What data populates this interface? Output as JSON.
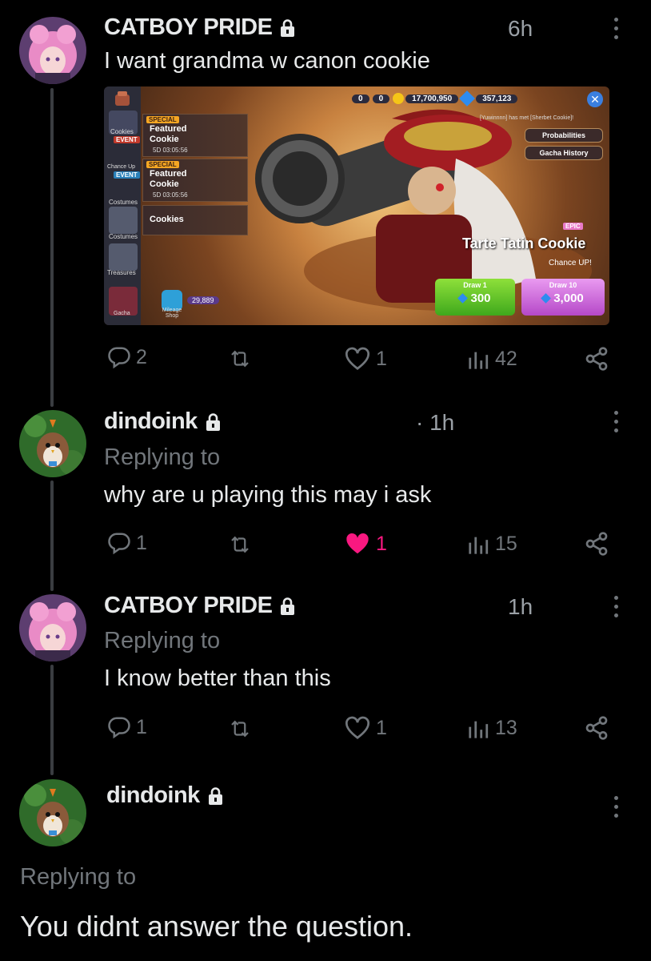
{
  "posts": [
    {
      "author": "CATBOY PRIDE",
      "time": "6h",
      "text": "I want grandma w canon cookie",
      "replies": "2",
      "likes": "1",
      "views": "42"
    },
    {
      "author": "dindoink",
      "time": "· 1h",
      "replying_to": "Replying to",
      "text": "why are u playing this may i ask",
      "replies": "1",
      "likes": "1",
      "views": "15",
      "liked": true
    },
    {
      "author": "CATBOY PRIDE",
      "time": "1h",
      "replying_to": "Replying to",
      "text": "I know better than this",
      "replies": "1",
      "likes": "1",
      "views": "13"
    },
    {
      "author": "dindoink",
      "replying_to": "Replying to",
      "text": "You didnt answer the question."
    }
  ],
  "game": {
    "topbar": {
      "val1": "0",
      "val2": "0",
      "coins": "17,700,950",
      "gems": "357,123"
    },
    "sidebar": [
      "Cookies",
      "EVENT",
      "Chance Up",
      "EVENT",
      "Costumes",
      "Costumes",
      "Treasures",
      "Gacha"
    ],
    "banner1": {
      "tag": "SPECIAL",
      "title": "Featured Cookie",
      "timer": "5D 03:05:56"
    },
    "banner2": {
      "tag": "SPECIAL",
      "title": "Featured Cookie",
      "timer": "5D 03:05:56"
    },
    "banner3": {
      "title": "Cookies"
    },
    "notice": "[Yuwinnnn] has met [Sherbet Cookie]!",
    "probabilities": "Probabilities",
    "gacha_history": "Gacha History",
    "rarity": "EPIC",
    "cookie_name": "Tarte Tatin Cookie",
    "chance_up": "Chance UP!",
    "draw1_label": "Draw 1",
    "draw1_cost": "300",
    "draw10_label": "Draw 10",
    "draw10_cost": "3,000",
    "mileage_value": "29,889",
    "mileage_label": "Mileage Shop"
  },
  "colors": {
    "bg": "#000000",
    "text": "#e7e9ea",
    "muted": "#71767b",
    "like": "#f91880",
    "line": "#3a3d41"
  }
}
